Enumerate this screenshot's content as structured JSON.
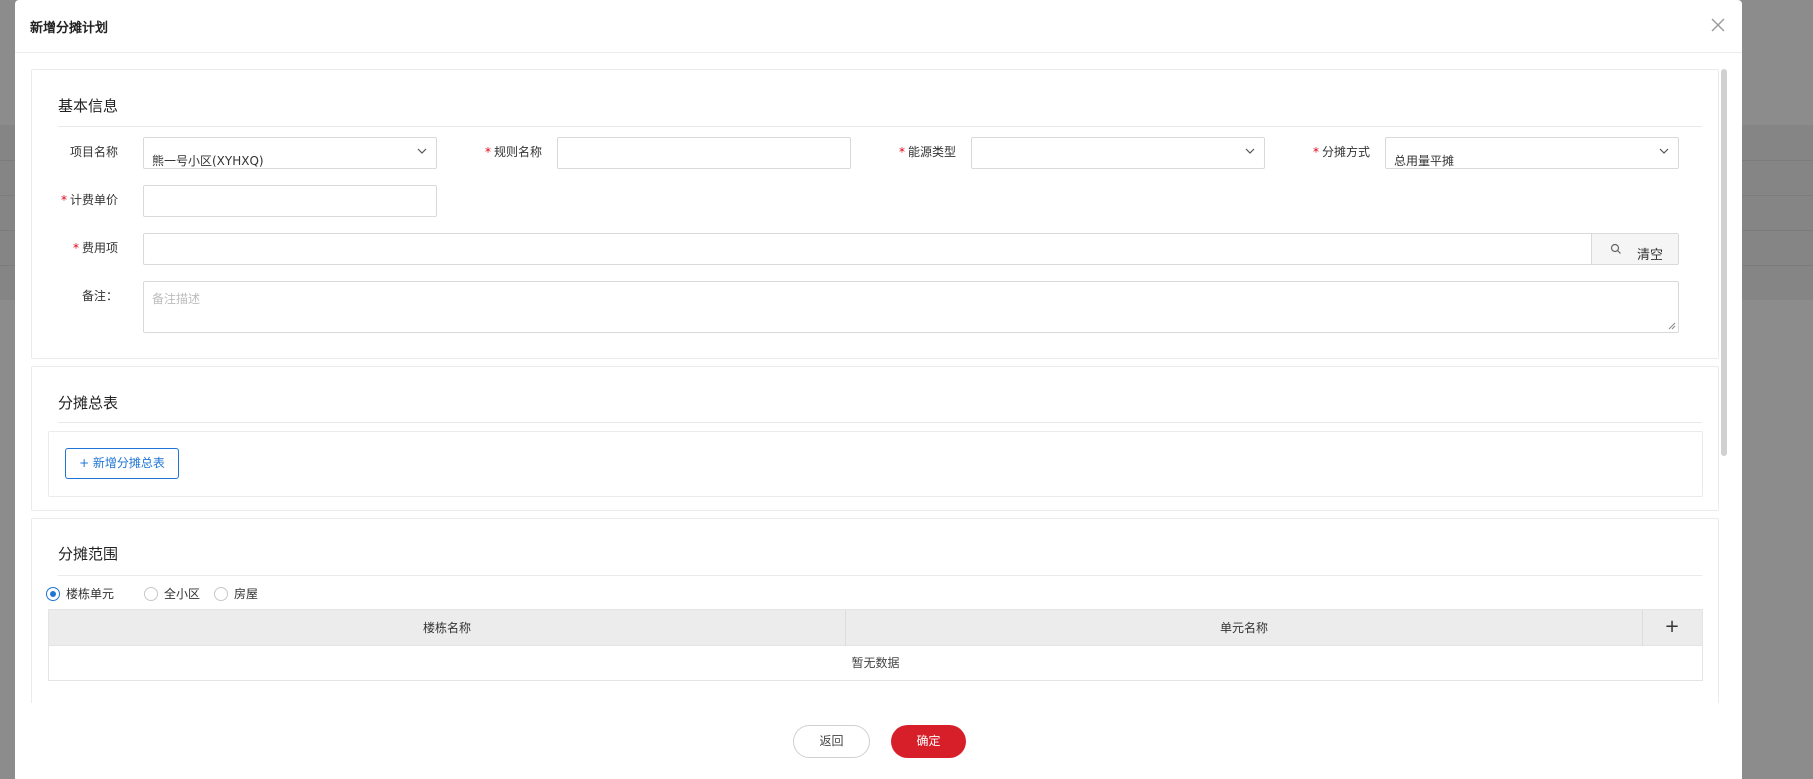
{
  "modal": {
    "title": "新增分摊计划"
  },
  "basic_info": {
    "section_title": "基本信息",
    "project": {
      "label": "项目名称",
      "value": "熊一号小区(XYHXQ)"
    },
    "rule_name": {
      "label": "规则名称",
      "value": ""
    },
    "energy_type": {
      "label": "能源类型",
      "value": ""
    },
    "method": {
      "label": "分摊方式",
      "value": "总用量平摊"
    },
    "unit_price": {
      "label": "计费单价",
      "value": ""
    },
    "fee_item": {
      "label": "费用项",
      "value": "",
      "clear_label": "清空"
    },
    "remark": {
      "label": "备注：",
      "placeholder": "备注描述"
    },
    "required_mark": "*"
  },
  "meter_section": {
    "section_title": "分摊总表",
    "add_button": "+ 新增分摊总表"
  },
  "scope_section": {
    "section_title": "分摊范围",
    "radios": [
      {
        "label": "楼栋单元",
        "checked": true
      },
      {
        "label": "全小区",
        "checked": false
      },
      {
        "label": "房屋",
        "checked": false
      }
    ],
    "table": {
      "columns": [
        "楼栋名称",
        "单元名称"
      ],
      "add_symbol": "+",
      "empty_text": "暂无数据"
    }
  },
  "footer": {
    "back_label": "返回",
    "confirm_label": "确定"
  },
  "colors": {
    "primary_blue": "#1e75d6",
    "confirm_red": "#d71f2a",
    "required_red": "#e60012"
  },
  "icons": [
    "close-icon",
    "chevron-down-icon",
    "search-icon",
    "resize-grip-icon"
  ]
}
